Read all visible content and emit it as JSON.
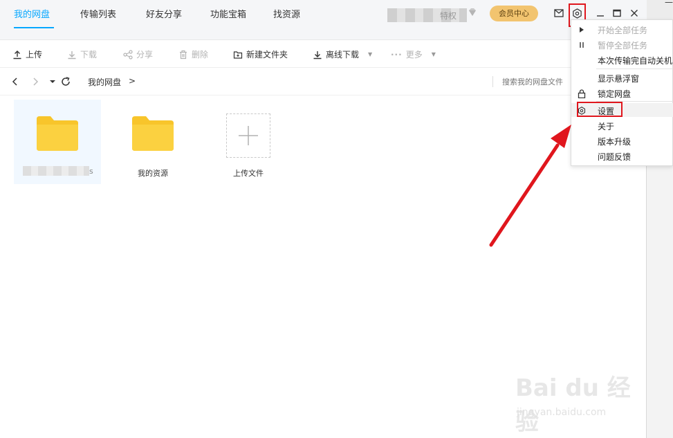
{
  "tabs": [
    {
      "label": "我的网盘"
    },
    {
      "label": "传输列表"
    },
    {
      "label": "好友分享"
    },
    {
      "label": "功能宝箱"
    },
    {
      "label": "找资源"
    }
  ],
  "header": {
    "user_extra": "特权",
    "vip_label": "会员中心",
    "right_strip_text": "—"
  },
  "toolbar": {
    "upload": "上传",
    "download": "下载",
    "share": "分享",
    "delete": "删除",
    "new_folder": "新建文件夹",
    "offline_download": "离线下载",
    "more": "更多"
  },
  "nav": {
    "breadcrumb": "我的网盘",
    "separator": ">",
    "search_placeholder": "搜索我的网盘文件"
  },
  "files": [
    {
      "name": "s",
      "type": "folder",
      "selected": true
    },
    {
      "name": "我的资源",
      "type": "folder"
    },
    {
      "name": "上传文件",
      "type": "upload"
    }
  ],
  "menu": {
    "items": [
      {
        "label": "开始全部任务",
        "disabled": true
      },
      {
        "label": "暂停全部任务",
        "disabled": true
      },
      {
        "label": "本次传输完自动关机"
      },
      {
        "label": "显示悬浮窗"
      },
      {
        "label": "锁定网盘"
      },
      {
        "label": "设置"
      },
      {
        "label": "关于"
      },
      {
        "label": "版本升级"
      },
      {
        "label": "问题反馈"
      }
    ]
  },
  "watermark": {
    "brand": "Bai du 经验",
    "url": "jingyan.baidu.com"
  },
  "colors": {
    "accent": "#06a7ff",
    "vip": "#f2c46f",
    "folder": "#f8c52b",
    "highlight": "#e0161d"
  }
}
